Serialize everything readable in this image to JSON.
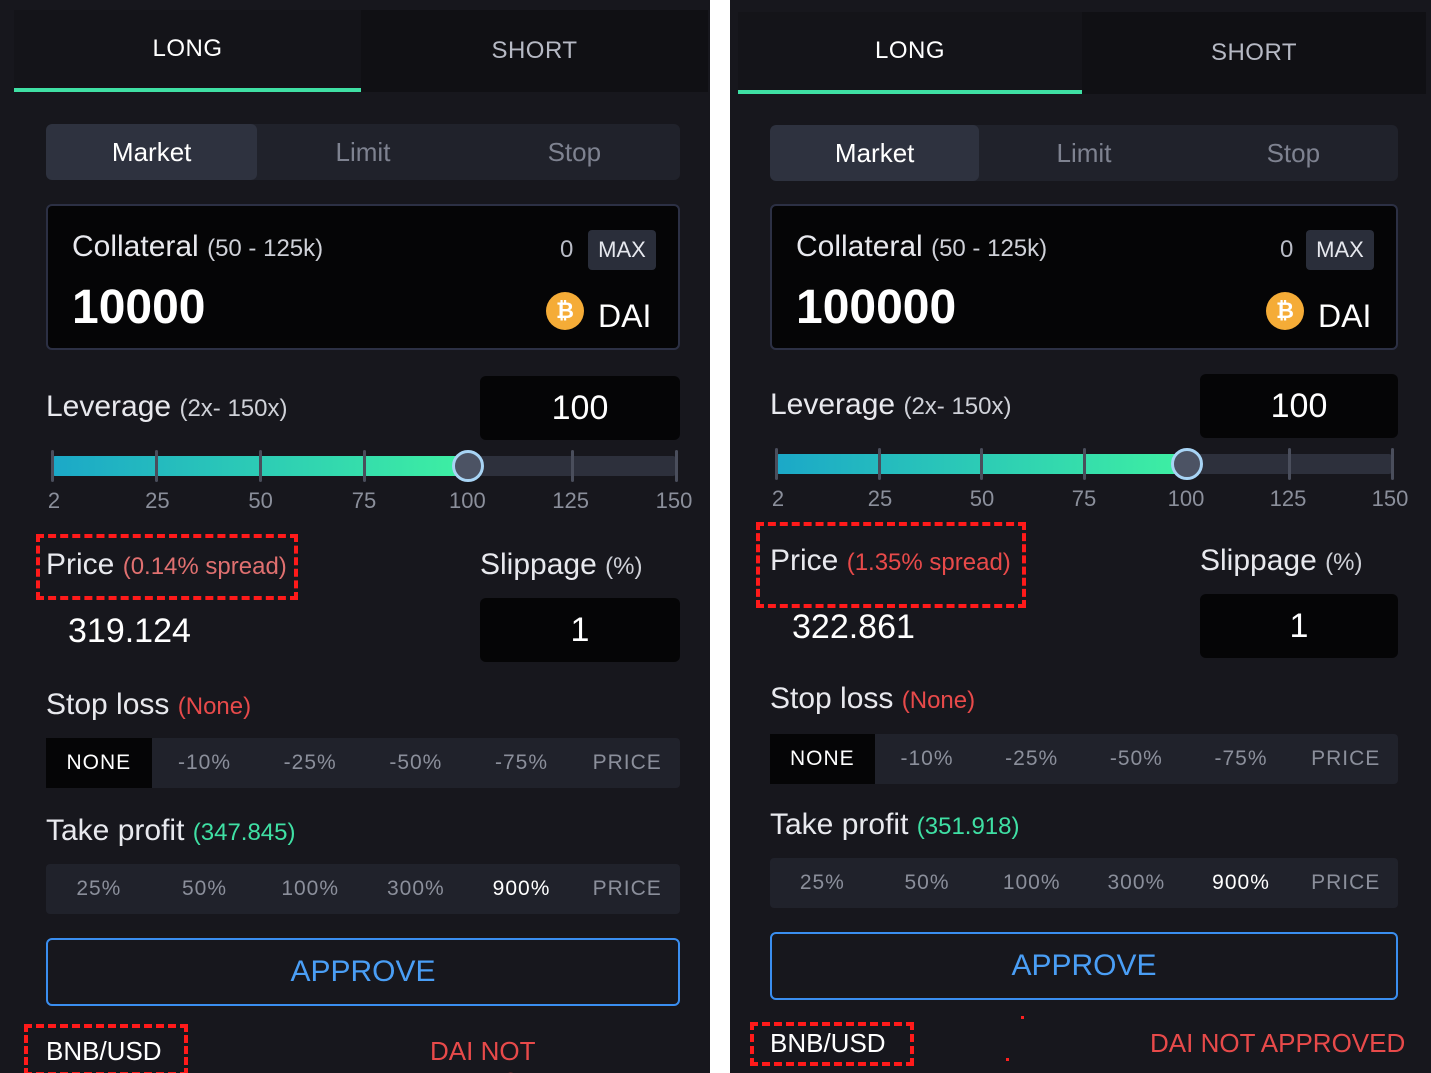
{
  "panels": [
    {
      "tabs": {
        "long": "LONG",
        "short": "SHORT",
        "active": "long"
      },
      "order_types": [
        "Market",
        "Limit",
        "Stop"
      ],
      "order_type_selected": "Market",
      "collateral": {
        "label": "Collateral",
        "range": "(50 - 125k)",
        "balance": "0",
        "max_label": "MAX",
        "value": "10000",
        "token": "DAI",
        "token_icon": "dai-coin-icon",
        "token_color": "#f5ac37"
      },
      "leverage": {
        "label": "Leverage",
        "range": "(2x- 150x)",
        "value": "100",
        "slider_min": 2,
        "slider_max": 150,
        "slider_value": 100,
        "ticks": [
          "2",
          "25",
          "50",
          "75",
          "100",
          "125",
          "150"
        ]
      },
      "price": {
        "label": "Price",
        "spread": "(0.14% spread)",
        "value": "319.124"
      },
      "slippage": {
        "label": "Slippage",
        "unit": "(%)",
        "value": "1"
      },
      "stop_loss": {
        "label": "Stop loss",
        "status": "(None)",
        "options": [
          "NONE",
          "-10%",
          "-25%",
          "-50%",
          "-75%",
          "PRICE"
        ],
        "selected": 0
      },
      "take_profit": {
        "label": "Take profit",
        "status": "(347.845)",
        "options": [
          "25%",
          "50%",
          "100%",
          "300%",
          "900%",
          "PRICE"
        ],
        "selected": 4
      },
      "approve_label": "APPROVE",
      "pair": "BNB/USD",
      "approval_status": "DAI NOT APPROVED"
    },
    {
      "tabs": {
        "long": "LONG",
        "short": "SHORT",
        "active": "long"
      },
      "order_types": [
        "Market",
        "Limit",
        "Stop"
      ],
      "order_type_selected": "Market",
      "collateral": {
        "label": "Collateral",
        "range": "(50 - 125k)",
        "balance": "0",
        "max_label": "MAX",
        "value": "100000",
        "token": "DAI",
        "token_icon": "dai-coin-icon",
        "token_color": "#f5ac37"
      },
      "leverage": {
        "label": "Leverage",
        "range": "(2x- 150x)",
        "value": "100",
        "slider_min": 2,
        "slider_max": 150,
        "slider_value": 100,
        "ticks": [
          "2",
          "25",
          "50",
          "75",
          "100",
          "125",
          "150"
        ]
      },
      "price": {
        "label": "Price",
        "spread": "(1.35% spread)",
        "value": "322.861"
      },
      "slippage": {
        "label": "Slippage",
        "unit": "(%)",
        "value": "1"
      },
      "stop_loss": {
        "label": "Stop loss",
        "status": "(None)",
        "options": [
          "NONE",
          "-10%",
          "-25%",
          "-50%",
          "-75%",
          "PRICE"
        ],
        "selected": 0
      },
      "take_profit": {
        "label": "Take profit",
        "status": "(351.918)",
        "options": [
          "25%",
          "50%",
          "100%",
          "300%",
          "900%",
          "PRICE"
        ],
        "selected": 4
      },
      "approve_label": "APPROVE",
      "pair": "BNB/USD",
      "approval_status": "DAI NOT APPROVED"
    }
  ],
  "colors": {
    "panel_bg": "#17171d",
    "accent_green": "#3fe0a4",
    "approve_blue": "#3a8ef0",
    "warning_red": "#e84a4a",
    "annotation_red": "#ff1a1a"
  }
}
